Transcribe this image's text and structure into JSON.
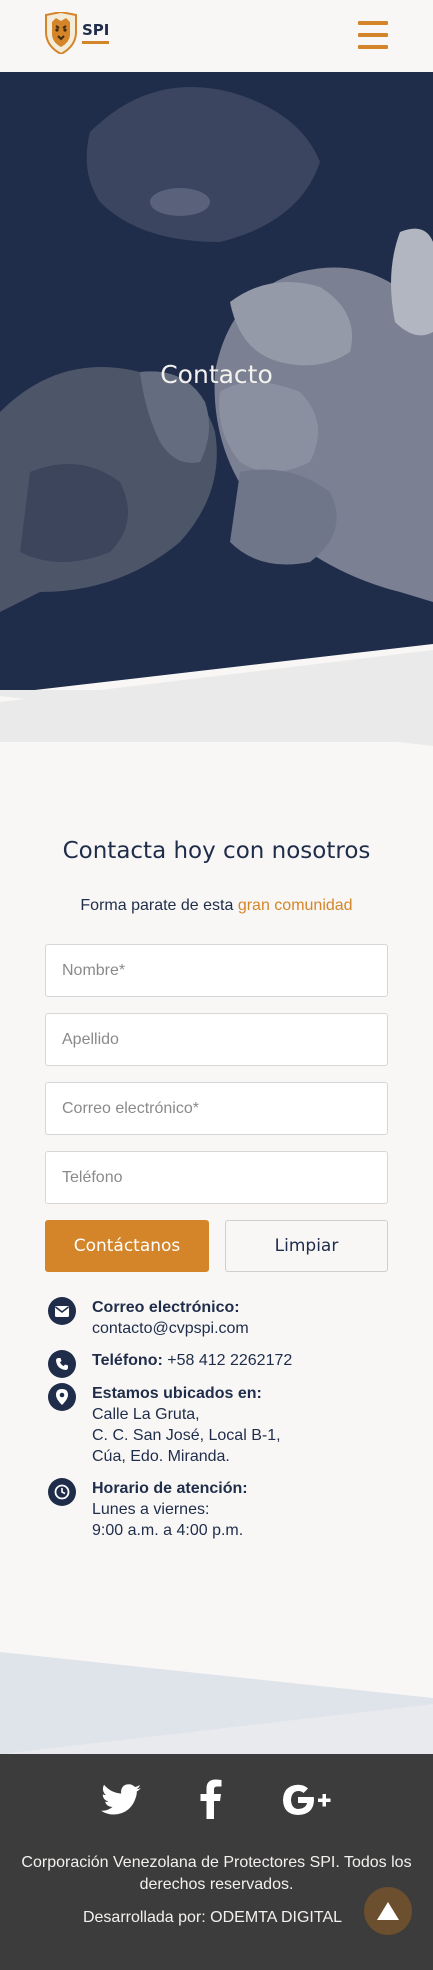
{
  "header": {
    "logo_text": "SPI",
    "menu_icon": "hamburger-icon"
  },
  "hero": {
    "title": "Contacto"
  },
  "contact": {
    "heading": "Contacta hoy con nosotros",
    "sub_prefix": "Forma parate de esta ",
    "sub_accent": "gran comunidad",
    "form": {
      "first_name_placeholder": "Nombre*",
      "last_name_placeholder": "Apellido",
      "email_placeholder": "Correo electrónico*",
      "phone_placeholder": "Teléfono",
      "submit_label": "Contáctanos",
      "clear_label": "Limpiar"
    },
    "info": {
      "email_label": "Correo electrónico:",
      "email_value": "contacto@cvpspi.com",
      "phone_label": "Teléfono:",
      "phone_value": " +58 412 2262172",
      "location_label": "Estamos ubicados en:",
      "location_line1": "Calle La Gruta,",
      "location_line2": "C. C. San José, Local B-1,",
      "location_line3": "Cúa, Edo. Miranda.",
      "hours_label": "Horario de atención:",
      "hours_line1": "Lunes a viernes:",
      "hours_line2": "9:00 a.m. a 4:00 p.m."
    }
  },
  "footer": {
    "social_icons": [
      "twitter-icon",
      "facebook-icon",
      "google-plus-icon"
    ],
    "copyright": "Corporación Venezolana de Protectores SPI. Todos los derechos reservados.",
    "developer": "Desarrollada por: ODEMTA DIGITAL",
    "back_to_top_icon": "arrow-up-icon"
  },
  "colors": {
    "navy": "#1f2d4a",
    "accent": "#d4852a",
    "background": "#f8f7f5",
    "footer": "#3d3c3c"
  }
}
